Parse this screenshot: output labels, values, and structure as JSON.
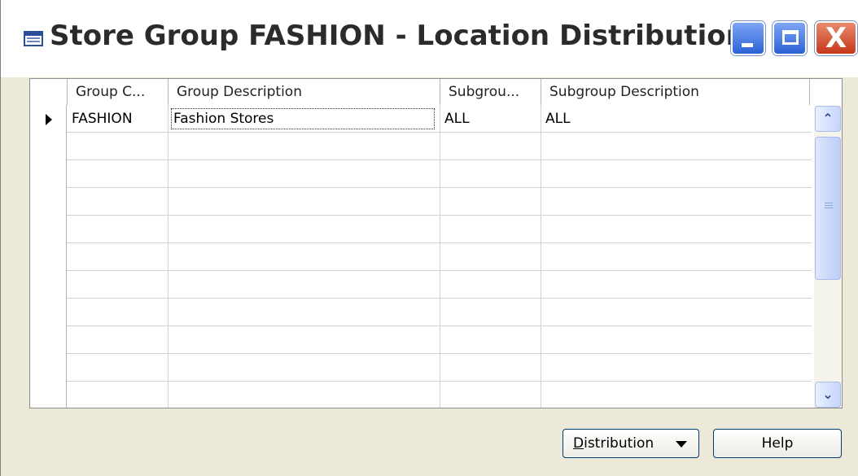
{
  "window": {
    "title": "Store Group FASHION - Location Distribution",
    "close_glyph": "X"
  },
  "grid": {
    "columns": [
      "Group C...",
      "Group Description",
      "Subgrou...",
      "Subgroup Description"
    ],
    "rows": [
      {
        "group_code": "FASHION",
        "group_description": "Fashion Stores",
        "subgroup_code": "ALL",
        "subgroup_description": "ALL"
      }
    ],
    "empty_row_count": 10,
    "scroll_up_glyph": "⌃",
    "scroll_down_glyph": "⌄"
  },
  "buttons": {
    "distribution_mnemonic": "D",
    "distribution_rest": "istribution",
    "help": "Help"
  }
}
